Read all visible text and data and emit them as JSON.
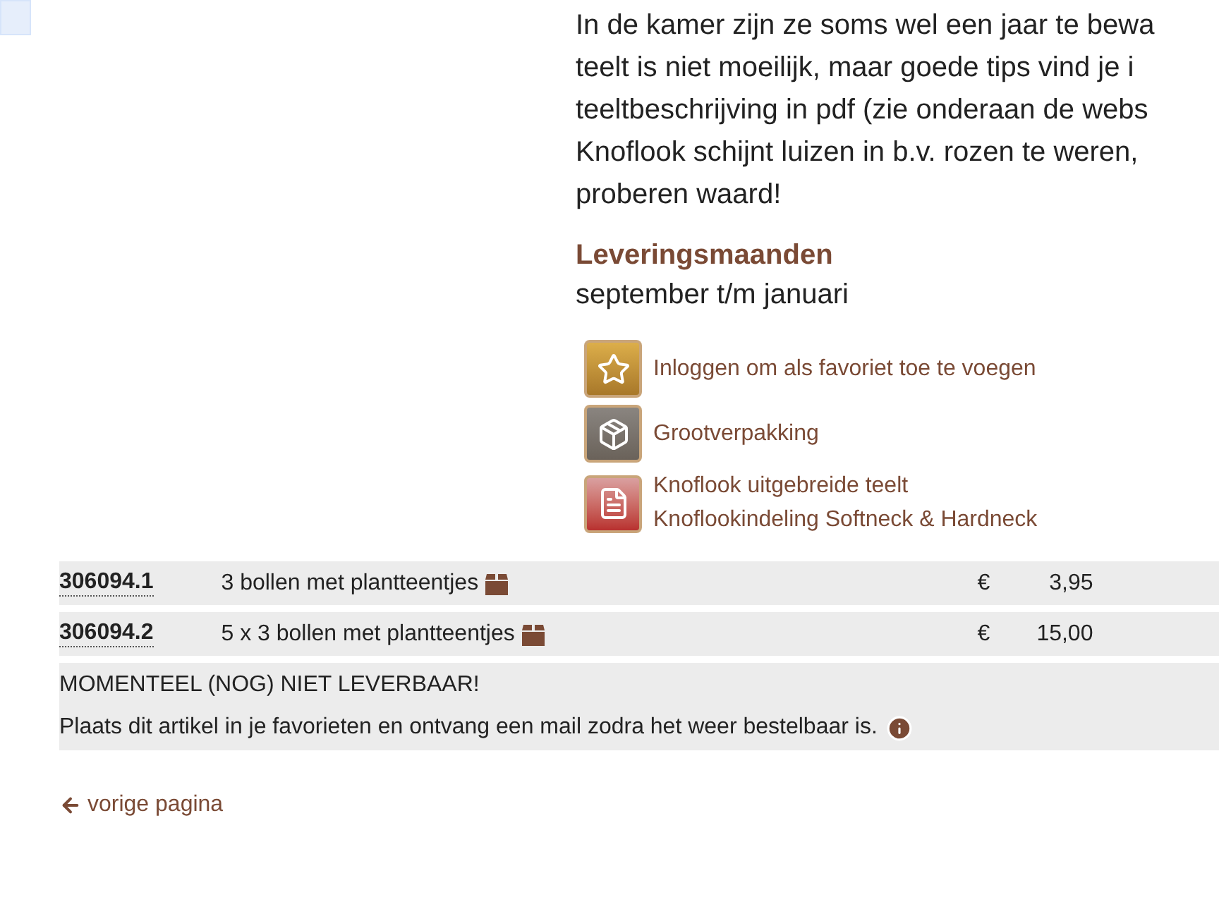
{
  "description_lines": [
    "In de kamer zijn ze soms wel een jaar te bewa",
    "teelt is niet moeilijk, maar goede tips vind je i",
    "teeltbeschrijving in pdf (zie onderaan de webs",
    "Knoflook schijnt luizen in b.v. rozen te weren,",
    "proberen waard!"
  ],
  "delivery": {
    "heading": "Leveringsmaanden",
    "value": "september t/m januari"
  },
  "links": [
    {
      "kind": "favorite",
      "texts": [
        "Inloggen om als favoriet toe te voegen"
      ]
    },
    {
      "kind": "bulk",
      "texts": [
        "Grootverpakking"
      ]
    },
    {
      "kind": "document",
      "texts": [
        "Knoflook uitgebreide teelt",
        "Knoflookindeling Softneck & Hardneck"
      ]
    }
  ],
  "products": [
    {
      "code": "306094.1",
      "name": "3 bollen met plantteentjes",
      "currency": "€",
      "price": "3,95"
    },
    {
      "code": "306094.2",
      "name": "5 x 3 bollen met plantteentjes",
      "currency": "€",
      "price": "15,00"
    }
  ],
  "notice": {
    "title": "MOMENTEEL (NOG) NIET LEVERBAAR!",
    "text": "Plaats dit artikel in je favorieten en ontvang een mail zodra het weer bestelbaar is."
  },
  "back_link": "vorige pagina"
}
